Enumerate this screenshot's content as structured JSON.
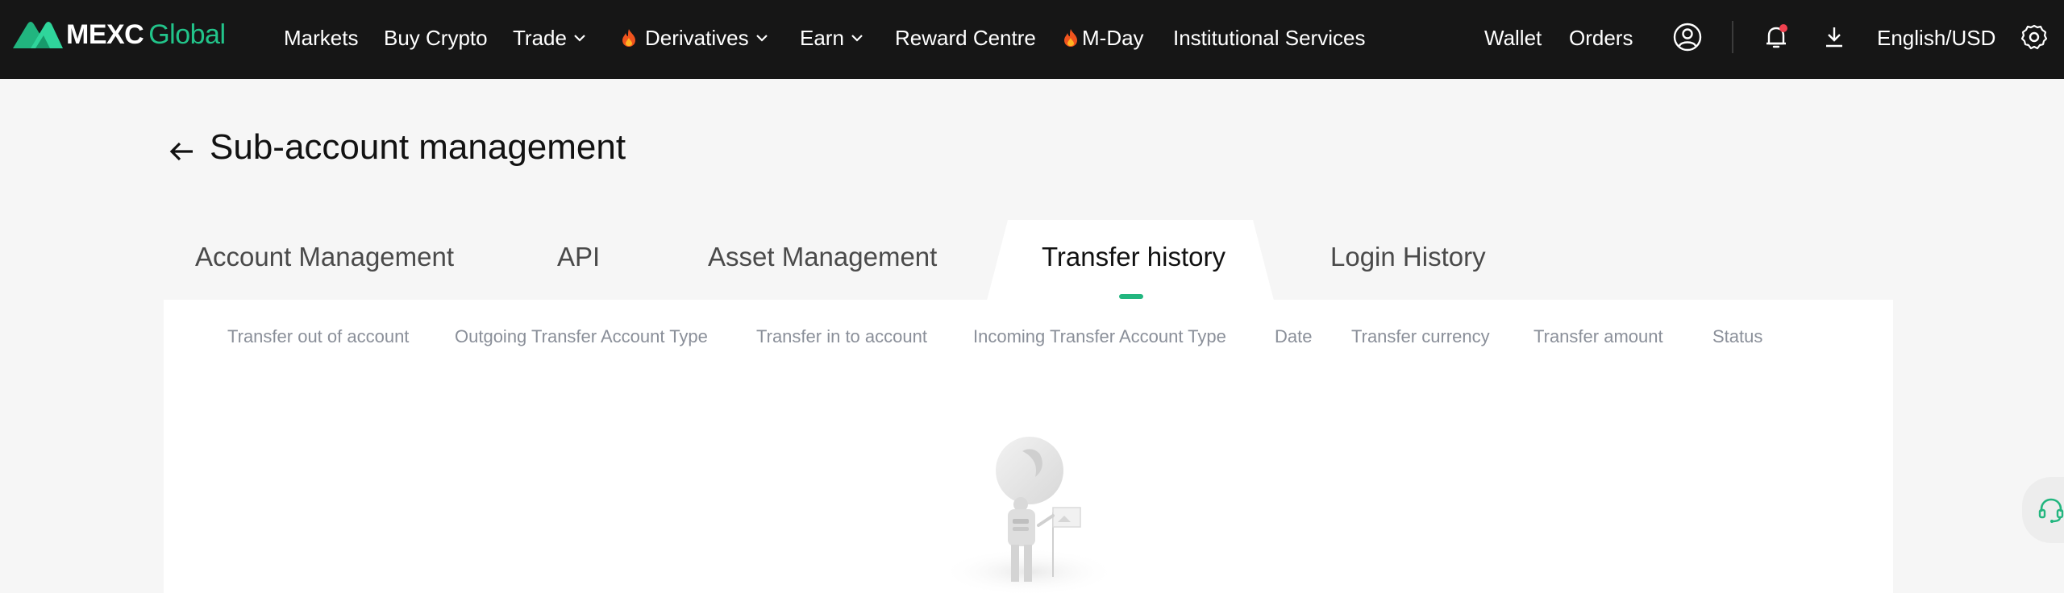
{
  "brand": {
    "name": "MEXC",
    "suffix": "Global",
    "accent_color": "#22c48a"
  },
  "nav": {
    "items": [
      {
        "label": "Markets",
        "has_dropdown": false,
        "hot": false
      },
      {
        "label": "Buy Crypto",
        "has_dropdown": false,
        "hot": false
      },
      {
        "label": "Trade",
        "has_dropdown": true,
        "hot": false
      },
      {
        "label": "Derivatives",
        "has_dropdown": true,
        "hot": true
      },
      {
        "label": "Earn",
        "has_dropdown": true,
        "hot": false
      },
      {
        "label": "Reward Centre",
        "has_dropdown": false,
        "hot": false
      },
      {
        "label": "M-Day",
        "has_dropdown": false,
        "hot": true
      },
      {
        "label": "Institutional Services",
        "has_dropdown": false,
        "hot": false
      }
    ],
    "wallet": "Wallet",
    "orders": "Orders",
    "language": "English/USD",
    "icons": [
      "user-icon",
      "bell-icon",
      "download-icon",
      "gear-icon"
    ],
    "notification_dot_color": "#f0414f"
  },
  "page": {
    "title": "Sub-account management"
  },
  "tabs": [
    {
      "label": "Account Management",
      "active": false
    },
    {
      "label": "API",
      "active": false
    },
    {
      "label": "Asset Management",
      "active": false
    },
    {
      "label": "Transfer history",
      "active": true
    },
    {
      "label": "Login History",
      "active": false
    }
  ],
  "table": {
    "columns": [
      "Transfer out of account",
      "Outgoing Transfer Account Type",
      "Transfer in to account",
      "Incoming Transfer Account Type",
      "Date",
      "Transfer currency",
      "Transfer amount",
      "Status"
    ],
    "rows": []
  },
  "colors": {
    "topbar": "#161616",
    "active_tab_indicator": "#22b67f",
    "support_icon": "#22b67f"
  }
}
